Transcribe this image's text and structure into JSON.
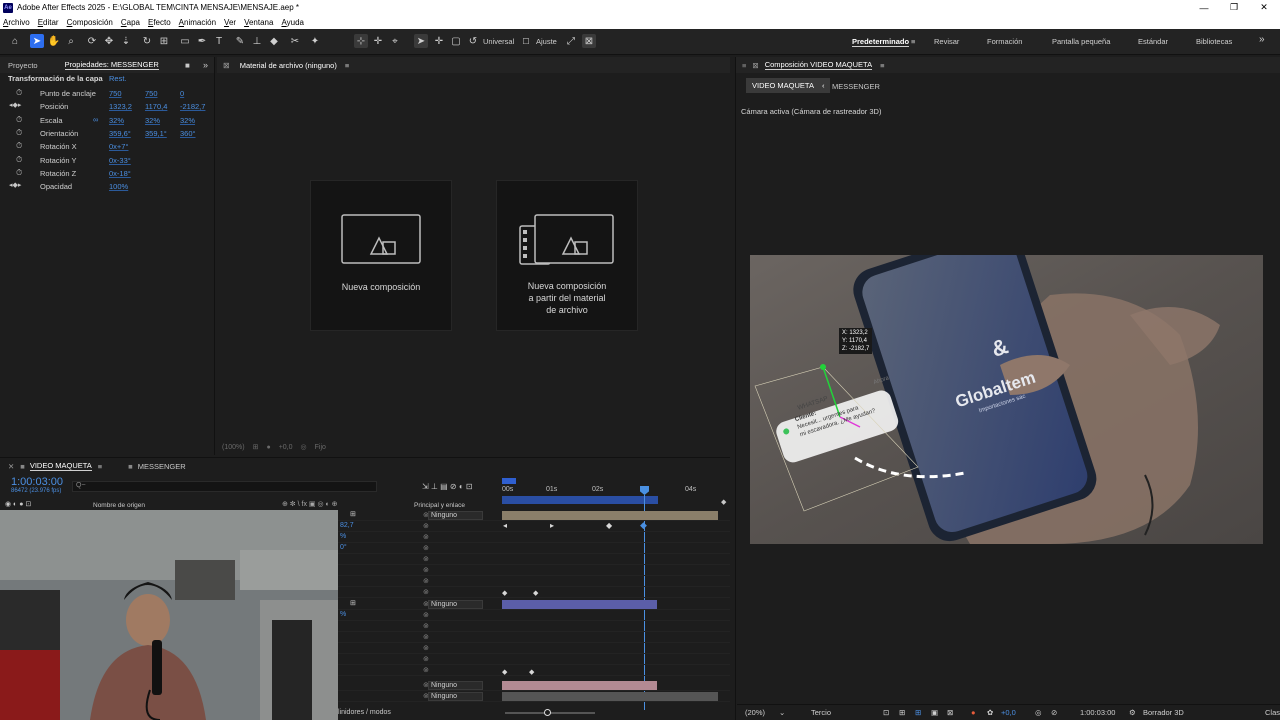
{
  "window": {
    "app_icon": "Ae",
    "title": "Adobe After Effects 2025 - E:\\GLOBAL TEM\\CINTA MENSAJE\\MENSAJE.aep *",
    "minimize": "—",
    "restore": "❐",
    "close": "✕"
  },
  "menu": [
    "Archivo",
    "Editar",
    "Composición",
    "Capa",
    "Efecto",
    "Animación",
    "Ver",
    "Ventana",
    "Ayuda"
  ],
  "toolbar": {
    "universal_label": "Universal",
    "ajuste_label": "Ajuste",
    "workspaces": [
      "Predeterminado",
      "Revisar",
      "Formación",
      "Pantalla pequeña",
      "Estándar",
      "Bibliotecas"
    ],
    "active_workspace": "Predeterminado",
    "more": "»"
  },
  "left_panel": {
    "tabs": [
      "Proyecto",
      "Propiedades: MESSENGER"
    ],
    "heading": "Transformación de la capa",
    "reset": "Rest.",
    "properties": [
      {
        "label": "Punto de anclaje",
        "values": [
          "750",
          "750",
          "0"
        ],
        "keyframed": false
      },
      {
        "label": "Posición",
        "values": [
          "1323,2",
          "1170,4",
          "-2182,7"
        ],
        "keyframed": true
      },
      {
        "label": "Escala",
        "values": [
          "32%",
          "32%",
          "32%"
        ],
        "keyframed": false,
        "linked": true
      },
      {
        "label": "Orientación",
        "values": [
          "359,6°",
          "359,1°",
          "360°"
        ],
        "keyframed": false
      },
      {
        "label": "Rotación X",
        "values": [
          "0x+7°"
        ],
        "keyframed": false
      },
      {
        "label": "Rotación Y",
        "values": [
          "0x-33°"
        ],
        "keyframed": false
      },
      {
        "label": "Rotación Z",
        "values": [
          "0x-18°"
        ],
        "keyframed": false
      },
      {
        "label": "Opacidad",
        "values": [
          "100%"
        ],
        "keyframed": true
      }
    ]
  },
  "project_panel": {
    "tab": "Material de archivo (ninguno)",
    "new_comp": "Nueva composición",
    "new_comp_from_footage": [
      "Nueva composición",
      "a partir del material",
      "de archivo"
    ],
    "footer_zoom": "(100%)",
    "footer_value": "+0,0",
    "footer_fit": "Fijo"
  },
  "comp_panel": {
    "tab": "Composición VIDEO MAQUETA",
    "breadcrumbs": [
      "VIDEO MAQUETA",
      "MESSENGER"
    ],
    "camera_label": "Cámara activa (Cámara de rastreador 3D)",
    "coord_readout": {
      "x": "X: 1323,2",
      "y": "Y: 1170,4",
      "z": "Z: -2182,7"
    },
    "notification": {
      "app": "WHATSAP",
      "time": "Ahora",
      "line1": "Cliente:",
      "line2": "Necesit... urgentes para",
      "line3": "mi escavadora. ¿Me ayudan?"
    },
    "phone_brand": "Globaltem",
    "phone_subtitle": "Importaciones sac",
    "footer": {
      "zoom": "(20%)",
      "resolution": "Tercio",
      "exposure": "+0,0",
      "timecode": "1:00:03:00",
      "renderer": "Borrador 3D",
      "extra": "Clas"
    }
  },
  "timeline": {
    "tabs": [
      "VIDEO MAQUETA",
      "MESSENGER"
    ],
    "timecode": "1:00:03:00",
    "frame_info": "86472 (23.976 fps)",
    "search_placeholder": "Q~",
    "col_source": "Nombre de origen",
    "col_parent": "Principal y enlace",
    "ruler": [
      "00s",
      "01s",
      "02s",
      "04s"
    ],
    "parent_options": [
      "Ninguno",
      "Ninguno",
      "Ninguno",
      "Ninguno"
    ],
    "row_values": [
      "82,7",
      "%",
      "0°",
      "%"
    ],
    "bottom_label": "linidores / modos"
  },
  "colors": {
    "accent": "#2d6ef0",
    "value_blue": "#4b8fe2",
    "playhead": "#4a90e2",
    "track_tan": "#8b7f6a",
    "track_purple": "#5b5ea8",
    "track_pink": "#b38a93",
    "work_area": "#2f5fd0"
  }
}
